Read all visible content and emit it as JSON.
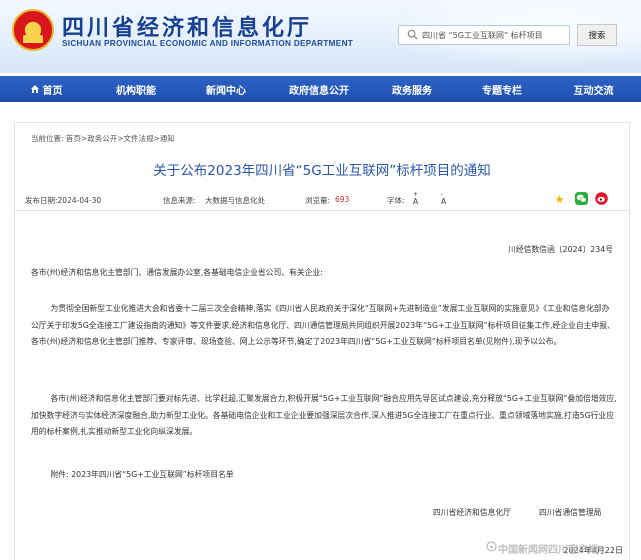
{
  "header": {
    "title": "四川省经济和信息化厅",
    "subtitle_en": "SICHUAN PROVINCIAL ECONOMIC AND INFORMATION DEPARTMENT",
    "search_value": "四川省 “5G工业互联网” 标杆项目",
    "search_button": "搜索"
  },
  "nav": [
    {
      "label": "首页"
    },
    {
      "label": "机构职能"
    },
    {
      "label": "新闻中心"
    },
    {
      "label": "政府信息公开"
    },
    {
      "label": "政务服务"
    },
    {
      "label": "专题专栏"
    },
    {
      "label": "互动交流"
    }
  ],
  "breadcrumb": "当前位置: 首页>政务公开>文件法规>通知",
  "article": {
    "title": "关于公布2023年四川省“5G工业互联网”标杆项目的通知",
    "publish_date": "发布日期:2024-04-30",
    "source_label": "信息来源:",
    "source_value": "大数据与信息化处",
    "views_label": "浏览量:",
    "views_value": "693",
    "font_label": "字体:",
    "font_large": "A",
    "font_small": "A",
    "doc_number": "川经信数信函〔2024〕234号",
    "recipients": "各市(州)经济和信息化主管部门、通信发展办公室,各基础电信企业省公司、有关企业:",
    "paragraph1": "为贯彻全国新型工业化推进大会和省委十二届三次全会精神,落实《四川省人民政府关于深化“互联网+先进制造业”发展工业互联网的实施意见》《工业和信息化部办公厅关于印发5G全连接工厂建设指南的通知》等文件要求,经济和信息化厅、四川通信管理局共同组织开展2023年“5G+工业互联网”标杆项目征集工作,经企业自主申报、各市(州)经济和信息化主管部门推荐、专家评审、现场查验、网上公示等环节,确定了2023年四川省“5G+工业互联网”标杆项目名单(见附件),现予以公布。",
    "paragraph2": "各市(州)经济和信息化主管部门要对标先进、比学赶超,汇聚发展合力,积极开展“5G+工业互联网”融合应用先导区试点建设,充分释放“5G+工业互联网”叠加倍增效应,加快数字经济与实体经济深度融合,助力新型工业化。各基础电信企业和工业企业要加强深层次合作,深入推进5G全连接工厂在重点行业、重点领域落地实施,打造5G行业应用的标杆案例,扎实推动新型工业化向纵深发展。",
    "attachment": "附件: 2023年四川省“5G+工业互联网”标杆项目名单",
    "issuer1": "四川省经济和信息化厅",
    "issuer2": "四川省通信管理局",
    "sign_date": "2024年4月22日"
  },
  "watermark": "中国新闻网四川客户端",
  "colors": {
    "nav": "#1e4fae",
    "title": "#2b57a8",
    "views": "#d0302a"
  }
}
